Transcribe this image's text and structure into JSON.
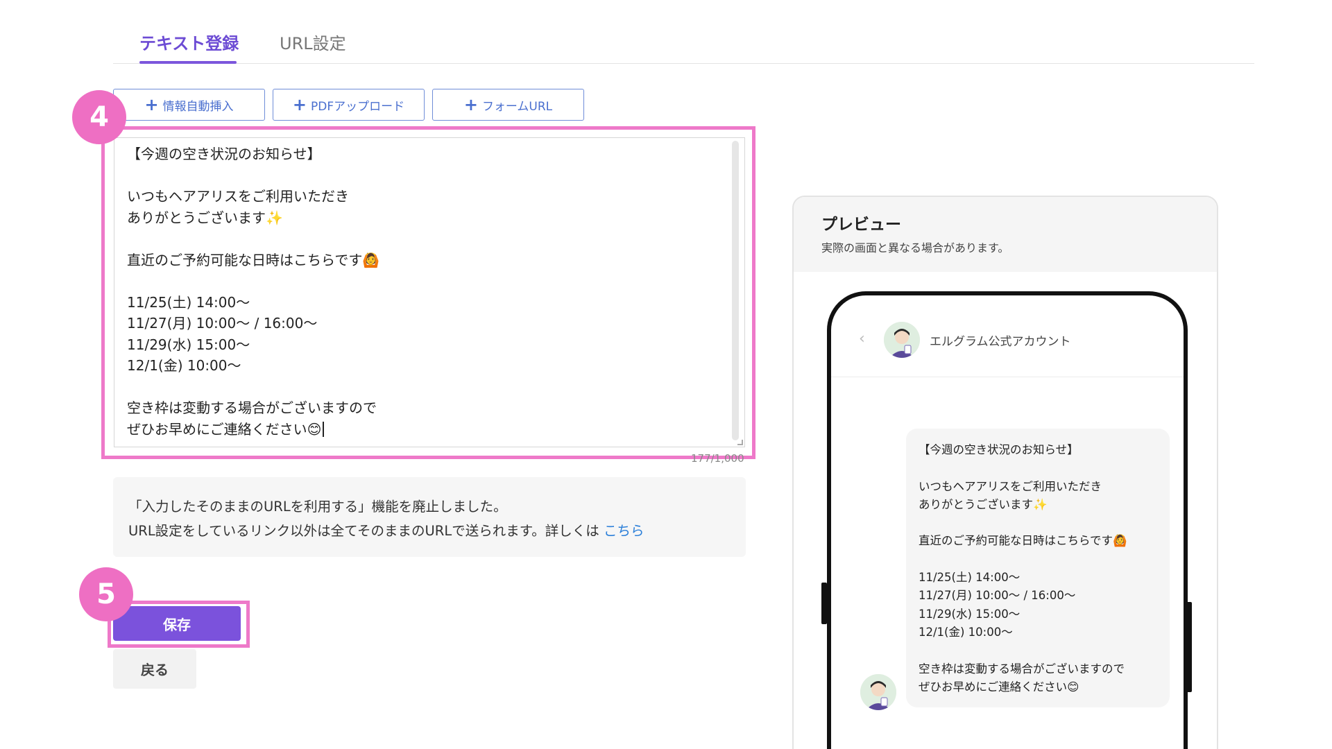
{
  "tabs": {
    "active": "テキスト登録",
    "inactive": "URL設定"
  },
  "insert_buttons": {
    "auto_info": "情報自動挿入",
    "pdf_upload": "PDFアップロード",
    "form_url": "フォームURL"
  },
  "editor": {
    "lines": [
      "【今週の空き状況のお知らせ】",
      "",
      "いつもヘアアリスをご利用いただき",
      "ありがとうございます✨",
      "",
      "直近のご予約可能な日時はこちらです🙆",
      "",
      "11/25(土) 14:00〜",
      "11/27(月) 10:00〜 / 16:00〜",
      "11/29(水) 15:00〜",
      "12/1(金) 10:00〜",
      "",
      "空き枠は変動する場合がございますので",
      "ぜひお早めにご連絡ください😊"
    ],
    "counter": "177/1,000"
  },
  "badges": {
    "step4": "4",
    "step5": "5"
  },
  "notice": {
    "line1": "「入力したそのままのURLを利用する」機能を廃止しました。",
    "line2": "URL設定をしているリンク以外は全てそのままのURLで送られます。詳しくは ",
    "link": "こちら"
  },
  "actions": {
    "save": "保存",
    "back": "戻る"
  },
  "preview": {
    "title": "プレビュー",
    "subtitle": "実際の画面と異なる場合があります。",
    "back_chevron": "‹",
    "account_name": "エルグラム公式アカウント",
    "message_lines": [
      "【今週の空き状況のお知らせ】",
      "",
      "いつもヘアアリスをご利用いただき",
      "ありがとうございます✨",
      "",
      "直近のご予約可能な日時はこちらです🙆",
      "",
      "11/25(土) 14:00〜",
      "11/27(月) 10:00〜 / 16:00〜",
      "11/29(水) 15:00〜",
      "12/1(金) 10:00〜",
      "",
      "空き枠は変動する場合がございますので",
      "ぜひお早めにご連絡ください😊"
    ]
  },
  "colors": {
    "accent": "#7b52dc",
    "highlight": "#ee79c9",
    "link": "#2b7fd9"
  }
}
